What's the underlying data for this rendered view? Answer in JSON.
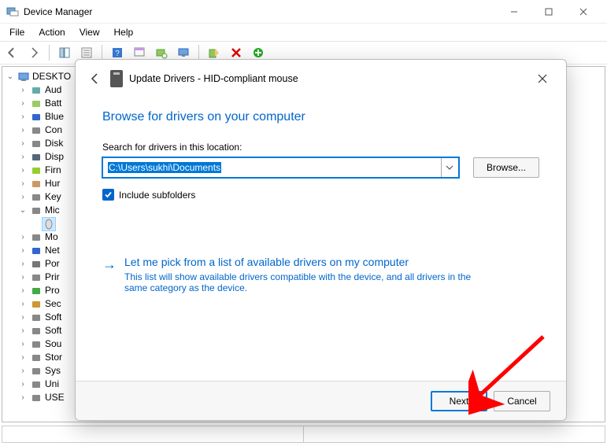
{
  "window": {
    "title": "Device Manager",
    "menus": [
      "File",
      "Action",
      "View",
      "Help"
    ]
  },
  "tree": {
    "root": "DESKTO",
    "items": [
      "Aud",
      "Batt",
      "Blue",
      "Con",
      "Disk",
      "Disp",
      "Firn",
      "Hur",
      "Key",
      "Mic",
      "",
      "Mo",
      "Net",
      "Por",
      "Prir",
      "Pro",
      "Sec",
      "Soft",
      "Soft",
      "Sou",
      "Stor",
      "Sys",
      "Uni",
      "USE"
    ],
    "expanded_index": 9,
    "highlighted_index": 10
  },
  "dialog": {
    "title": "Update Drivers - HID-compliant mouse",
    "heading": "Browse for drivers on your computer",
    "search_label": "Search for drivers in this location:",
    "path_value": "C:\\Users\\sukhi\\Documents",
    "browse_label": "Browse...",
    "include_subfolders_label": "Include subfolders",
    "include_subfolders_checked": true,
    "link_title": "Let me pick from a list of available drivers on my computer",
    "link_desc": "This list will show available drivers compatible with the device, and all drivers in the same category as the device.",
    "next_label": "Next",
    "cancel_label": "Cancel"
  }
}
